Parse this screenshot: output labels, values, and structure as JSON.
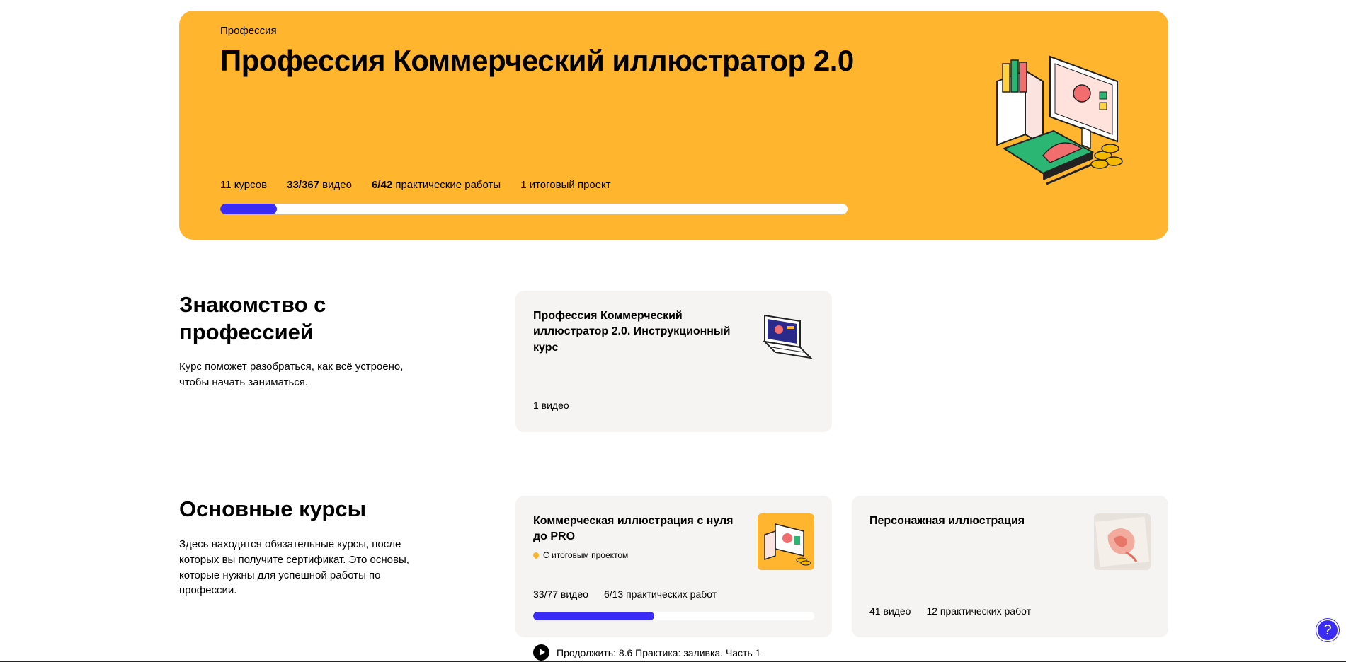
{
  "hero": {
    "eyebrow": "Профессия",
    "title": "Профессия Коммерческий иллюстратор 2.0",
    "stats": {
      "courses": "11 курсов",
      "videos_value": "33/367",
      "videos_label": " видео",
      "practice_value": "6/42",
      "practice_label": " практические работы",
      "final_project": "1 итоговый проект"
    },
    "progress": 0.09
  },
  "intro_section": {
    "title": "Знакомство с профессией",
    "description": "Курс поможет разобраться, как всё устроено, чтобы начать заниматься.",
    "card": {
      "title": "Профессия Коммерческий иллюстратор 2.0. Инструкционный курс",
      "meta": "1 видео"
    }
  },
  "main_section": {
    "title": "Основные курсы",
    "description": "Здесь находятся обязательные курсы, после которых вы получите сертификат. Это основы, которые нужны для успешной работы по профессии.",
    "cards": [
      {
        "title": "Коммерческая иллюстрация с нуля до PRO",
        "badge": "С итоговым проектом",
        "videos": "33/77 видео",
        "practice": "6/13 практических работ",
        "progress": 0.43
      },
      {
        "title": "Персонажная иллюстрация",
        "videos": "41 видео",
        "practice": "12 практических работ"
      }
    ],
    "continue_label": "Продолжить: 8.6 Практика: заливка. Часть 1"
  },
  "help": {
    "label": "?"
  },
  "colors": {
    "accent": "#3a2cf5",
    "hero_bg": "#ffb52e",
    "card_bg": "#f5f4f2"
  }
}
